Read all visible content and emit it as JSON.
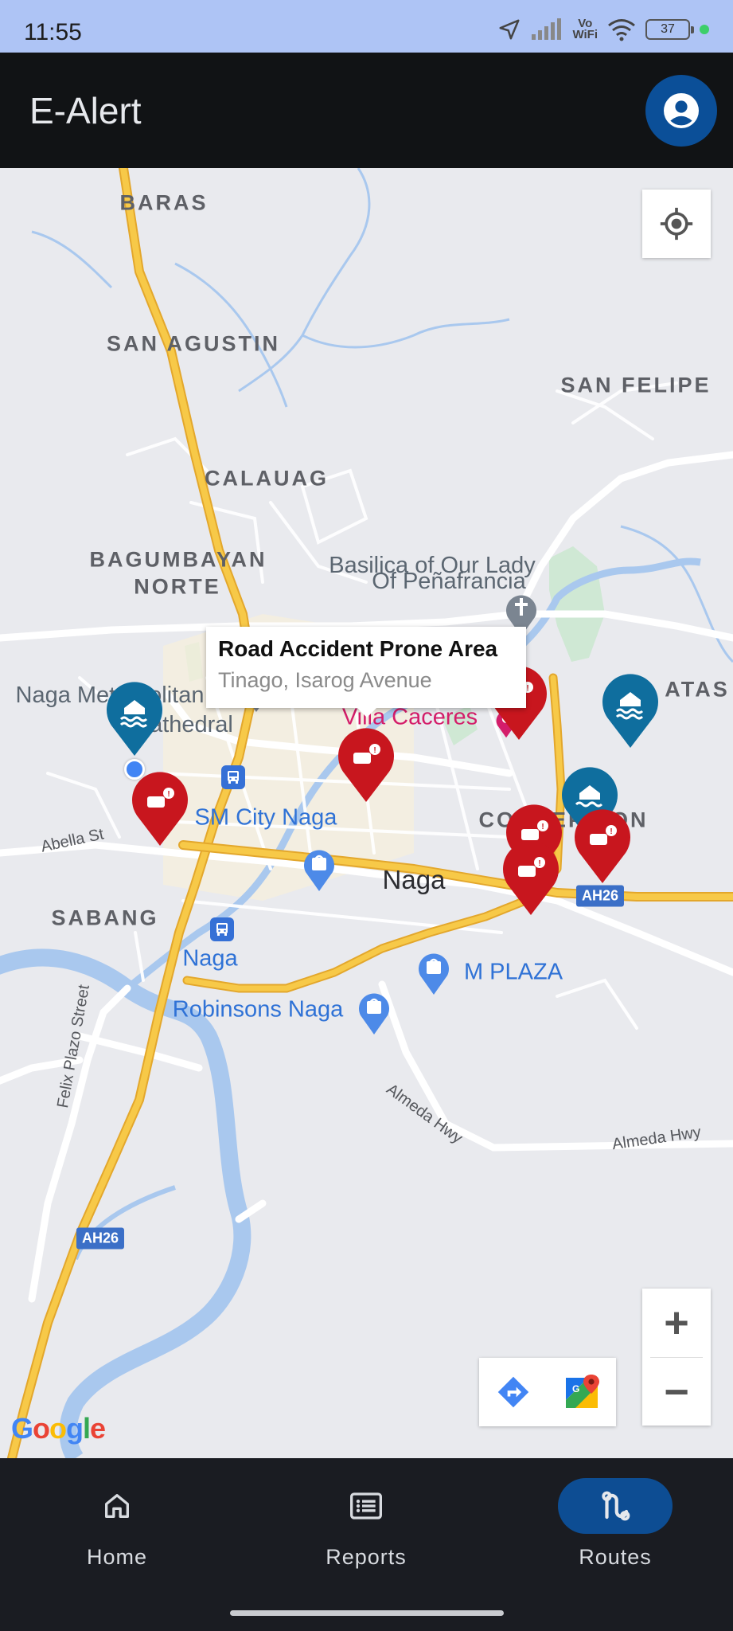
{
  "status_bar": {
    "time": "11:55",
    "vowifi_top": "Vo",
    "vowifi_bottom": "WiFi",
    "battery": "37",
    "icons": [
      "location-arrow-icon",
      "signal-icon",
      "wifi-icon",
      "battery-icon"
    ]
  },
  "app_bar": {
    "title": "E-Alert",
    "profile_icon": "account-circle-icon"
  },
  "map": {
    "areas": {
      "baras": "BARAS",
      "san_agustin": "SAN AGUSTIN",
      "san_felipe": "SAN FELIPE",
      "calauag": "CALAUAG",
      "bagumbayan_1": "BAGUMBAYAN",
      "bagumbayan_2": "NORTE",
      "sabang": "SABANG",
      "lerma_tatas": "ATAS",
      "concepcion": "CONCEPCION"
    },
    "pois": {
      "basilica_1": "Basilica of Our Lady",
      "basilica_2": "Of Peñafrancia",
      "cathedral_1": "Naga Metropolitan",
      "cathedral_2": "Cathedral",
      "villa_caceres": "Villa Caceres",
      "sm_city": "SM City Naga",
      "naga_city": "Naga",
      "naga_transit": "Naga",
      "m_plaza": "M PLAZA",
      "robinsons": "Robinsons Naga"
    },
    "roads": {
      "abella": "Abella St",
      "felix_plazo": "Felix Plazo Street",
      "almeda_1": "Almeda Hwy",
      "almeda_2": "Almeda Hwy",
      "ah26_a": "AH26",
      "ah26_b": "AH26"
    },
    "info_window": {
      "title": "Road Accident Prone Area",
      "subtitle": "Tinago, Isarog Avenue"
    },
    "markers": {
      "accident_color": "#c8161e",
      "flood_color": "#0f6e9e"
    },
    "controls": {
      "locate_icon": "my-location-icon",
      "zoom_in": "+",
      "zoom_out": "−",
      "directions_icon": "directions-icon",
      "google_maps_icon": "google-maps-icon"
    },
    "attribution": "Google"
  },
  "bottom_nav": {
    "items": [
      {
        "label": "Home",
        "icon": "home-icon"
      },
      {
        "label": "Reports",
        "icon": "reports-icon"
      },
      {
        "label": "Routes",
        "icon": "routes-icon"
      }
    ],
    "active": "Routes",
    "active_color": "#0d4d93"
  }
}
